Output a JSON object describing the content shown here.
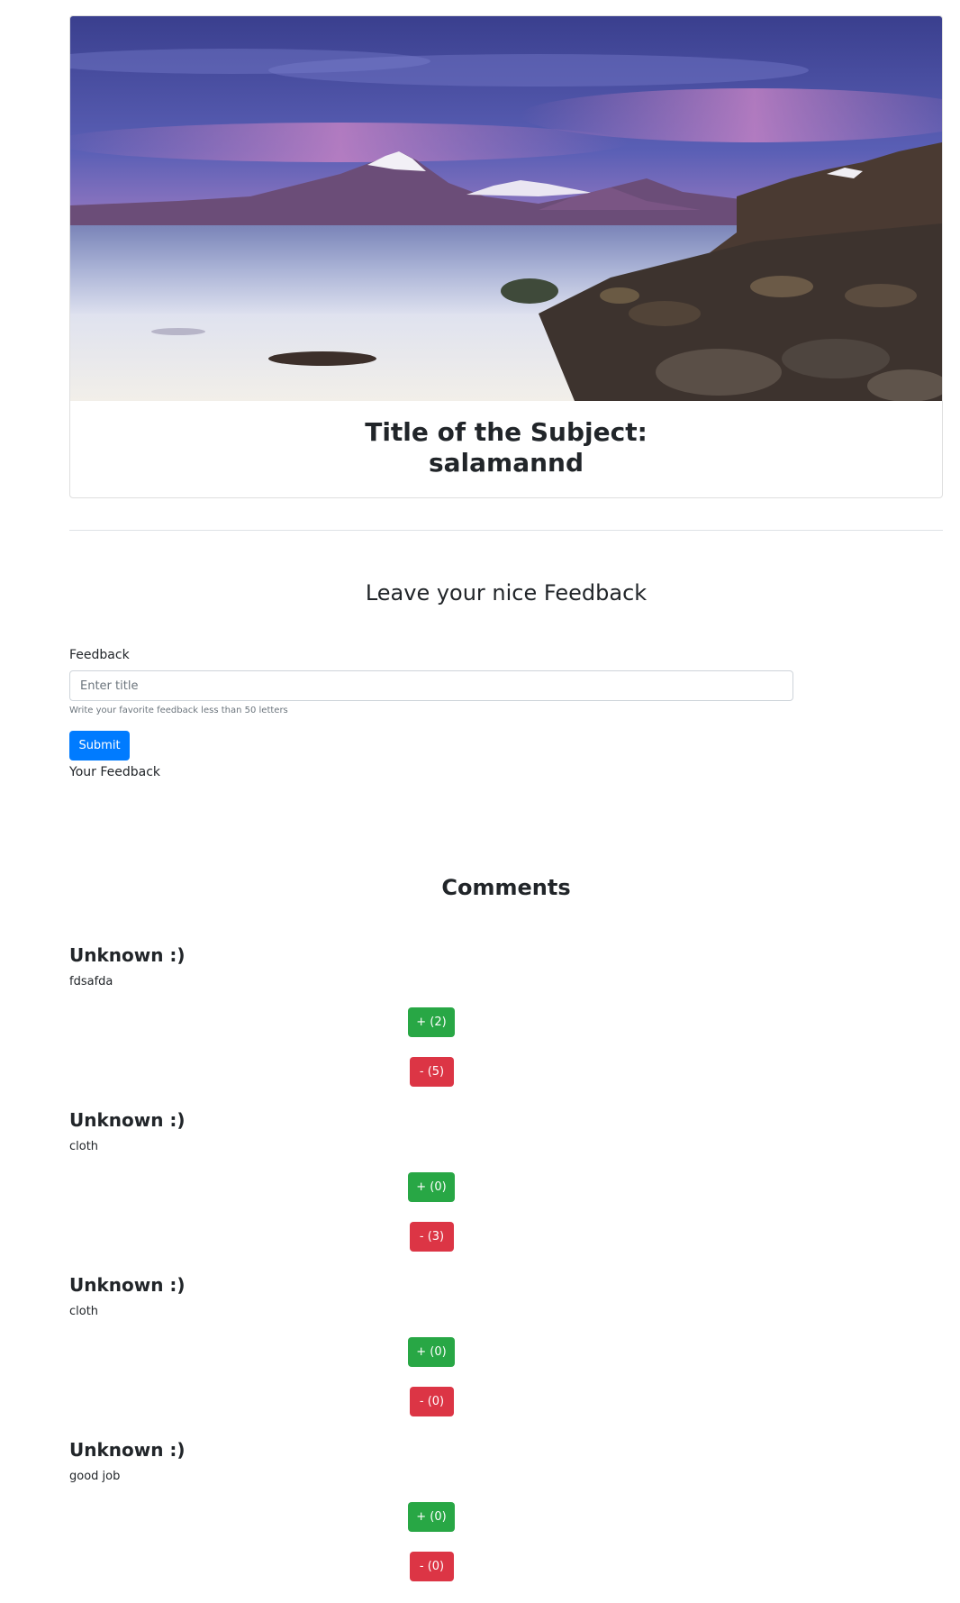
{
  "card": {
    "title_line1": "Title of the Subject:",
    "title_line2": "salamannd"
  },
  "feedback_form": {
    "heading": "Leave your nice Feedback",
    "label": "Feedback",
    "input_placeholder": "Enter title",
    "input_value": "",
    "help_text": "Write your favorite feedback less than 50 letters",
    "submit_label": "Submit",
    "your_feedback_label": "Your Feedback"
  },
  "comments": {
    "heading": "Comments",
    "items": [
      {
        "author": "Unknown :)",
        "text": "fdsafda",
        "plus_label": "+ (2)",
        "minus_label": "- (5)"
      },
      {
        "author": "Unknown :)",
        "text": "cloth",
        "plus_label": "+ (0)",
        "minus_label": "- (3)"
      },
      {
        "author": "Unknown :)",
        "text": "cloth",
        "plus_label": "+ (0)",
        "minus_label": "- (0)"
      },
      {
        "author": "Unknown :)",
        "text": "good job",
        "plus_label": "+ (0)",
        "minus_label": "- (0)"
      }
    ]
  },
  "colors": {
    "primary": "#007bff",
    "success": "#28a745",
    "danger": "#dc3545",
    "border": "#dee2e6",
    "text": "#212529",
    "muted": "#6c757d"
  }
}
